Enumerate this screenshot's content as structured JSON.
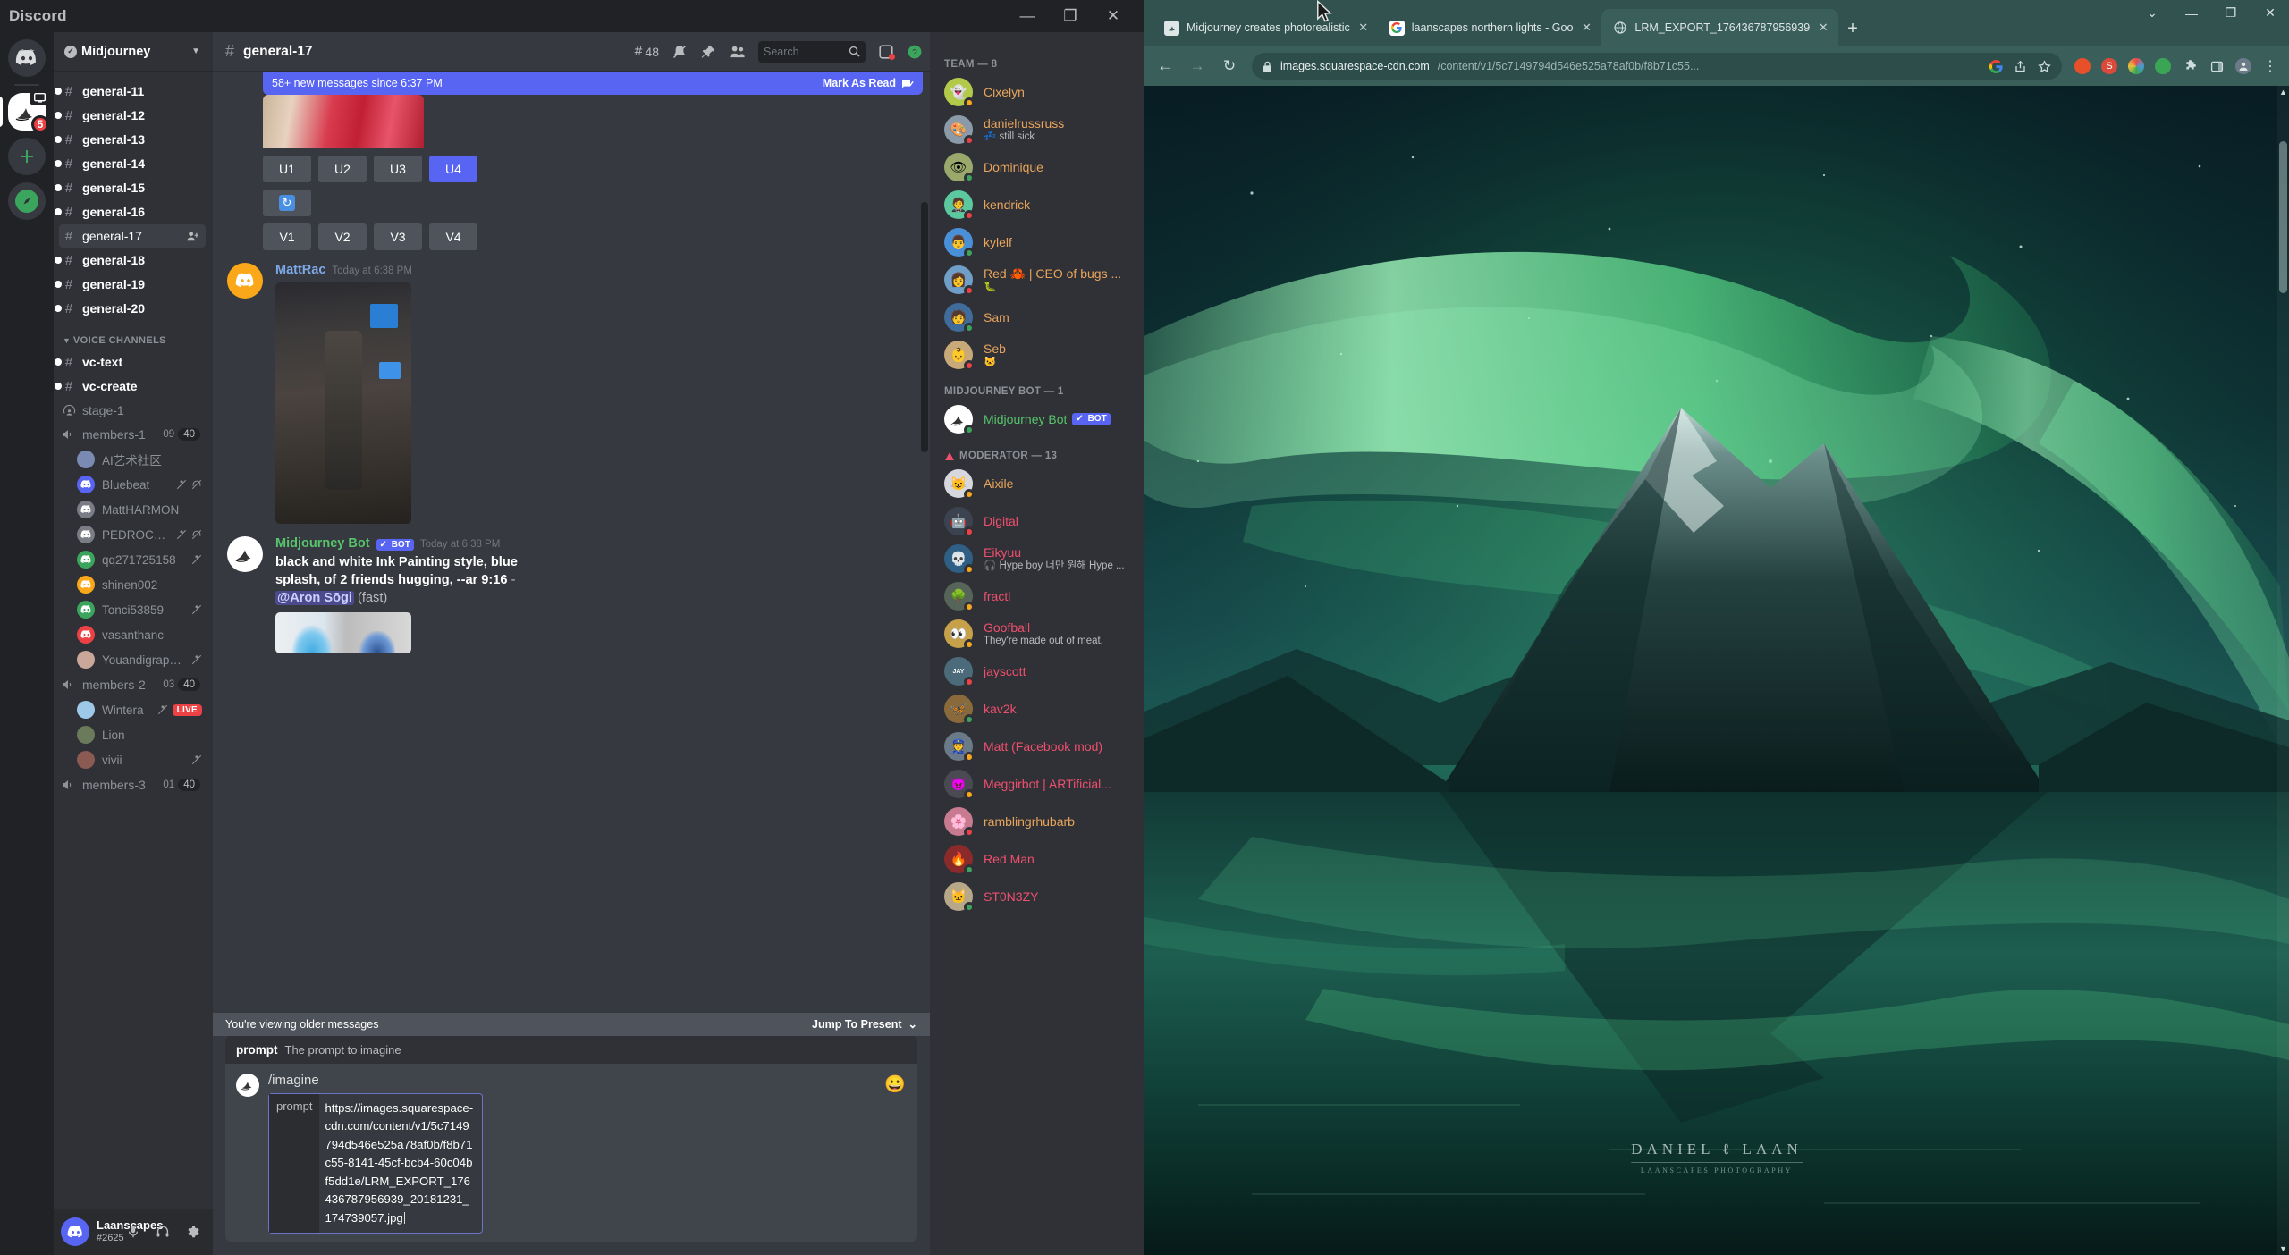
{
  "discord": {
    "window_title": "Discord",
    "window_buttons": [
      "—",
      "❐",
      "✕"
    ],
    "guild_rail": {
      "home_icon": "discord-home-icon",
      "midjourney_badge": "5",
      "add_server_icon": "plus-icon",
      "explore_icon": "compass-icon"
    },
    "guild": {
      "name": "Midjourney",
      "verified": true
    },
    "channels": [
      {
        "label": "general-11",
        "icon": "hash-lock-icon",
        "unread": true,
        "active": false
      },
      {
        "label": "general-12",
        "icon": "hash-lock-icon",
        "unread": true,
        "active": false
      },
      {
        "label": "general-13",
        "icon": "hash-lock-icon",
        "unread": true,
        "active": false
      },
      {
        "label": "general-14",
        "icon": "hash-lock-icon",
        "unread": true,
        "active": false
      },
      {
        "label": "general-15",
        "icon": "hash-lock-icon",
        "unread": true,
        "active": false
      },
      {
        "label": "general-16",
        "icon": "hash-lock-icon",
        "unread": true,
        "active": false
      },
      {
        "label": "general-17",
        "icon": "hash-lock-icon",
        "unread": false,
        "active": true
      },
      {
        "label": "general-18",
        "icon": "hash-lock-icon",
        "unread": true,
        "active": false
      },
      {
        "label": "general-19",
        "icon": "hash-lock-icon",
        "unread": true,
        "active": false
      },
      {
        "label": "general-20",
        "icon": "hash-lock-icon",
        "unread": true,
        "active": false
      }
    ],
    "voice_category": {
      "label": "VOICE CHANNELS"
    },
    "voice_channels": [
      {
        "label": "vc-text",
        "icon": "hash-lock-icon",
        "kind": "text",
        "unread": true
      },
      {
        "label": "vc-create",
        "icon": "hash-lock-icon",
        "kind": "text",
        "unread": true
      },
      {
        "label": "stage-1",
        "icon": "stage-icon",
        "kind": "stage"
      },
      {
        "label": "members-1",
        "icon": "speaker-lock-icon",
        "kind": "voice",
        "count_left": "09",
        "count_right": "40"
      }
    ],
    "voice_members_1": [
      {
        "name": "AI艺术社区",
        "avatar": "#7b8ab3",
        "icons": []
      },
      {
        "name": "Bluebeat",
        "avatar": "#5865f2",
        "icons": [
          "mic-muted-icon",
          "headset-muted-icon"
        ]
      },
      {
        "name": "MattHARMON",
        "avatar": "#7a7d85",
        "icons": []
      },
      {
        "name": "PEDROCOELHO...",
        "avatar": "#7a7d85",
        "icons": [
          "mic-muted-icon",
          "headset-muted-icon"
        ]
      },
      {
        "name": "qq271725158",
        "avatar": "#3ba55d",
        "icons": [
          "mic-muted-icon"
        ]
      },
      {
        "name": "shinen002",
        "avatar": "#faa81a",
        "icons": []
      },
      {
        "name": "Tonci53859",
        "avatar": "#3ba55d",
        "icons": [
          "mic-muted-icon"
        ]
      },
      {
        "name": "vasanthanc",
        "avatar": "#ed4245",
        "icons": []
      },
      {
        "name": "Youandigraphics",
        "avatar": "#c9a89a",
        "icons": [
          "mic-muted-icon"
        ]
      }
    ],
    "voice_channel_2": {
      "label": "members-2",
      "icon": "speaker-lock-icon",
      "count_left": "03",
      "count_right": "40"
    },
    "voice_members_2": [
      {
        "name": "Wintera",
        "avatar": "#9ec8e8",
        "icons": [
          "mic-muted-icon"
        ],
        "live": "LIVE"
      },
      {
        "name": "Lion",
        "avatar": "#6b7a5a",
        "icons": []
      },
      {
        "name": "vivii",
        "avatar": "#8b5a52",
        "icons": [
          "mic-muted-icon"
        ]
      }
    ],
    "voice_channel_3": {
      "label": "members-3",
      "icon": "speaker-lock-icon",
      "count_left": "01",
      "count_right": "40"
    },
    "user_panel": {
      "name": "Laanscapes",
      "tag": "#2625",
      "mic_icon": "microphone-icon",
      "headset_icon": "headset-icon",
      "settings_icon": "gear-icon"
    },
    "chat_header": {
      "hash_icon": "hash-lock-icon",
      "channel": "general-17",
      "threads_icon": "threads-icon",
      "threads_count": "48",
      "bell_icon": "bell-muted-icon",
      "pin_icon": "pin-icon",
      "members_icon": "members-icon",
      "inbox_icon": "inbox-icon",
      "help_icon": "help-icon"
    },
    "search": {
      "placeholder": "Search",
      "value": "",
      "icon": "search-icon"
    },
    "new_messages_bar": {
      "text": "58+ new messages since 6:37 PM",
      "action": "Mark As Read",
      "icon": "mark-read-icon"
    },
    "midjourney_buttons": {
      "upscale": [
        "U1",
        "U2",
        "U3",
        "U4"
      ],
      "selected": "U4",
      "reroll_icon": "reroll-icon",
      "variation": [
        "V1",
        "V2",
        "V3",
        "V4"
      ]
    },
    "messages": [
      {
        "author": "MattRac",
        "timestamp": "Today at 6:38 PM",
        "author_color_class": "mattrac",
        "has_image": true
      },
      {
        "author": "Midjourney Bot",
        "bot_tag": "BOT",
        "timestamp": "Today at 6:38 PM",
        "author_color_class": "mjbot",
        "prompt_line1": "black and white Ink Painting style, blue splash,",
        "prompt_line2": "of 2 friends hugging, --ar 9:16",
        "prompt_dash": "-",
        "mention": "@Aron Sōgi",
        "fast": "(fast)"
      }
    ],
    "older_messages_bar": {
      "text": "You're viewing older messages",
      "action": "Jump To Present",
      "chevron": "⌄"
    },
    "composer": {
      "hint_key": "prompt",
      "hint_desc": "The prompt to imagine",
      "command": "/imagine",
      "arg_key": "prompt",
      "arg_value": "https://images.squarespace-cdn.com/content/v1/5c7149794d546e525a78af0b/f8b71c55-8141-45cf-bcb4-60c04bf5dd1e/LRM_EXPORT_176436787956939_20181231_174739057.jpg",
      "emoji_icon": "emoji-icon"
    },
    "member_list": {
      "sections": [
        {
          "title": "TEAM — 8",
          "members": [
            {
              "name": "Cixelyn",
              "sub": "",
              "status": "idle",
              "color": "#b3c94a",
              "role": "team"
            },
            {
              "name": "danielrussruss",
              "sub": "💤 still sick",
              "status": "dnd",
              "color": "#8a9aa8",
              "role": "team"
            },
            {
              "name": "Dominique",
              "sub": "",
              "status": "online",
              "color": "#9aa86b",
              "role": "team"
            },
            {
              "name": "kendrick",
              "sub": "",
              "status": "dnd",
              "color": "#5bc8a0",
              "role": "team"
            },
            {
              "name": "kylelf",
              "sub": "",
              "status": "online",
              "color": "#4a90d9",
              "role": "team"
            },
            {
              "name": "Red 🦀 | CEO of bugs ...",
              "sub": "🐛",
              "status": "dnd",
              "color": "#6f9ec8",
              "role": "team"
            },
            {
              "name": "Sam",
              "sub": "",
              "status": "online",
              "color": "#3f6c9a",
              "role": "team"
            },
            {
              "name": "Seb",
              "sub": "🐱",
              "status": "dnd",
              "color": "#c8a97a",
              "role": "team"
            }
          ]
        },
        {
          "title": "MIDJOURNEY BOT — 1",
          "members": [
            {
              "name": "Midjourney Bot",
              "sub": "",
              "status": "online",
              "color": "#ffffff",
              "role": "bot",
              "bot_tag": "BOT"
            }
          ]
        },
        {
          "title": "MODERATOR — 13",
          "icon": "moderator-icon",
          "members": [
            {
              "name": "Aixile",
              "sub": "",
              "status": "idle",
              "color": "#d7d7e0",
              "role": "mod",
              "name_color": "#e8a45c"
            },
            {
              "name": "Digital",
              "sub": "",
              "status": "dnd",
              "color": "#3b4350",
              "role": "mod"
            },
            {
              "name": "Eikyuu",
              "sub": "🎧 Hype boy 너만 원해 Hype ...",
              "status": "idle",
              "color": "#2f5f84",
              "role": "mod"
            },
            {
              "name": "fractl",
              "sub": "",
              "status": "idle",
              "color": "#56645a",
              "role": "mod"
            },
            {
              "name": "Goofball",
              "sub": "They're made out of meat.",
              "status": "idle",
              "color": "#c6a14a",
              "role": "mod"
            },
            {
              "name": "jayscott",
              "sub": "",
              "status": "dnd",
              "color": "#4b6b7a",
              "role": "mod"
            },
            {
              "name": "kav2k",
              "sub": "",
              "status": "online",
              "color": "#8a6a3a",
              "role": "mod"
            },
            {
              "name": "Matt (Facebook mod)",
              "sub": "",
              "status": "idle",
              "color": "#6a7a88",
              "role": "mod"
            },
            {
              "name": "Meggirbot | ARTificial...",
              "sub": "",
              "status": "idle",
              "color": "#4a4a52",
              "role": "mod"
            },
            {
              "name": "ramblingrhubarb",
              "sub": "",
              "status": "dnd",
              "color": "#c87a90",
              "role": "mod",
              "name_color": "#e8a45c"
            },
            {
              "name": "Red Man",
              "sub": "",
              "status": "online",
              "color": "#8a2a2a",
              "role": "mod"
            },
            {
              "name": "ST0N3ZY",
              "sub": "",
              "status": "online",
              "color": "#b8a88a",
              "role": "mod"
            }
          ]
        }
      ]
    }
  },
  "browser": {
    "window_buttons": [
      "⌄",
      "—",
      "❐",
      "✕"
    ],
    "tabs": [
      {
        "title": "Midjourney creates photorealistic",
        "favicon": "midjourney-favicon",
        "active": false,
        "close": "✕"
      },
      {
        "title": "laanscapes northern lights - Goo",
        "favicon": "google-favicon",
        "active": false,
        "close": "✕"
      },
      {
        "title": "LRM_EXPORT_176436787956939",
        "favicon": "globe-favicon",
        "active": true,
        "close": "✕"
      }
    ],
    "new_tab_icon": "plus-icon",
    "toolbar": {
      "back_icon": "arrow-left-icon",
      "forward_icon": "arrow-right-icon",
      "reload_icon": "reload-icon",
      "lock_icon": "lock-icon",
      "url_host": "images.squarespace-cdn.com",
      "url_path": "/content/v1/5c7149794d546e525a78af0b/f8b71c55...",
      "google_icon": "google-icon",
      "share_icon": "share-icon",
      "bookmark_icon": "star-icon",
      "extensions": [
        {
          "name": "avast-extension-icon",
          "color": "#e8502a",
          "glyph": ""
        },
        {
          "name": "s-extension-icon",
          "color": "#d94a3a",
          "glyph": "S"
        },
        {
          "name": "color-extension-icon",
          "color": "#4a9ad4",
          "glyph": ""
        },
        {
          "name": "green-extension-icon",
          "color": "#3aa655",
          "glyph": ""
        },
        {
          "name": "puzzle-extension-icon",
          "color": "#cfdedc",
          "glyph": ""
        },
        {
          "name": "sidepanel-icon",
          "color": "#cfdedc",
          "glyph": ""
        },
        {
          "name": "profile-avatar",
          "color": "#6a7a88",
          "glyph": ""
        },
        {
          "name": "menu-kebab-icon",
          "color": "#cfdedc",
          "glyph": "⋮"
        }
      ]
    },
    "page": {
      "watermark_main": "DANIEL ℓ LAAN",
      "watermark_sub": "LAANSCAPES PHOTOGRAPHY",
      "alt": "northern lights aurora over mountain and lake"
    }
  }
}
